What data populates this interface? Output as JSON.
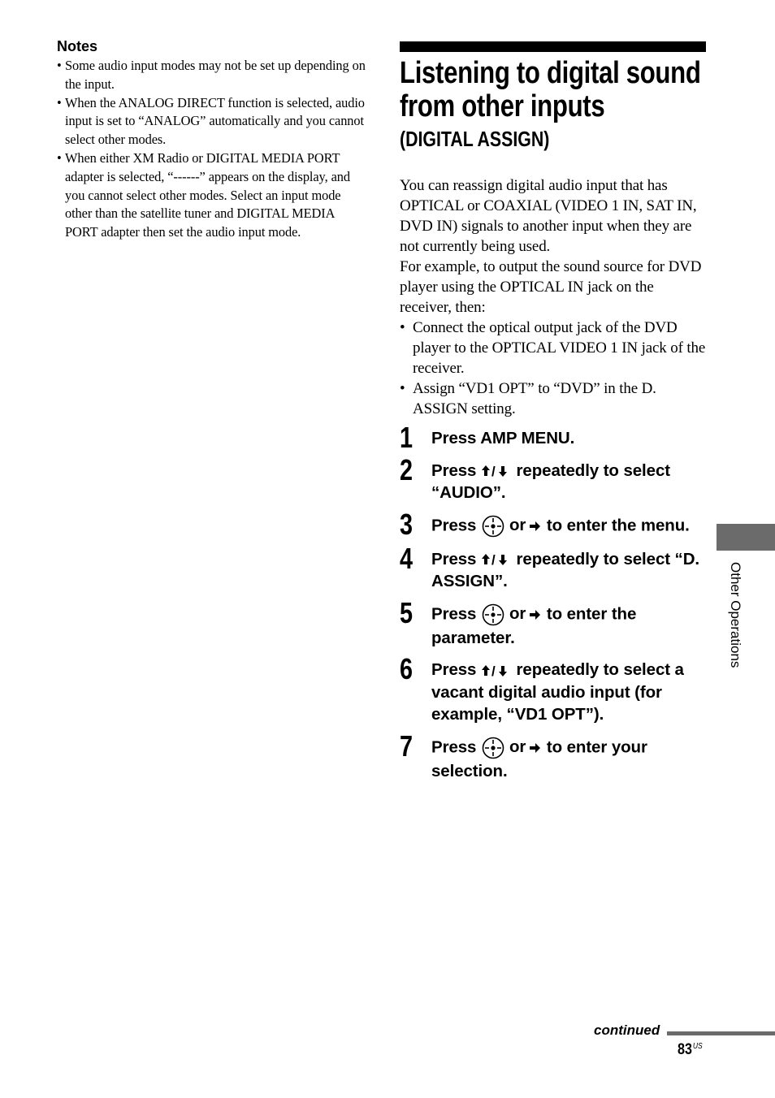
{
  "notes": {
    "title": "Notes",
    "items": [
      "Some audio input modes may not be set up depending on the input.",
      "When the ANALOG DIRECT function is selected, audio input is set to “ANALOG” automatically and you cannot select other modes.",
      "When either XM Radio or DIGITAL MEDIA PORT adapter is selected, “------” appears on the display, and you cannot select other modes. Select an input mode other than the satellite tuner and DIGITAL MEDIA PORT adapter then set the audio input mode."
    ]
  },
  "section": {
    "title": "Listening to digital sound from other inputs",
    "subtitle": "(DIGITAL ASSIGN)",
    "intro_paragraphs": [
      "You can reassign digital audio input that has OPTICAL or COAXIAL (VIDEO 1 IN, SAT IN, DVD IN) signals to another input when they are not currently being used.",
      "For example, to output the sound source for DVD player using the OPTICAL IN jack on the receiver, then:"
    ],
    "intro_bullets": [
      "Connect the optical output jack of the DVD player to the OPTICAL VIDEO 1 IN jack of the receiver.",
      "Assign “VD1 OPT” to “DVD” in the D. ASSIGN setting."
    ],
    "steps": [
      {
        "number": "1",
        "pre": "Press AMP MENU.",
        "icon": "",
        "post": ""
      },
      {
        "number": "2",
        "pre": "Press ",
        "icon": "up-down-arrows",
        "post": " repeatedly to select “AUDIO”."
      },
      {
        "number": "3",
        "pre": "Press ",
        "icon": "enter-button-or-right-arrow",
        "post": " to enter the menu."
      },
      {
        "number": "4",
        "pre": "Press ",
        "icon": "up-down-arrows",
        "post": " repeatedly to select “D. ASSIGN”."
      },
      {
        "number": "5",
        "pre": "Press ",
        "icon": "enter-button-or-right-arrow",
        "post": " to enter the parameter."
      },
      {
        "number": "6",
        "pre": "Press ",
        "icon": "up-down-arrows",
        "post": " repeatedly to select a vacant digital audio input (for example, “VD1 OPT”)."
      },
      {
        "number": "7",
        "pre": "Press ",
        "icon": "enter-button-or-right-arrow",
        "post": " to enter your selection."
      }
    ],
    "or_label": "or"
  },
  "side_tab": {
    "label": "Other Operations",
    "color": "#6b6b6b"
  },
  "footer": {
    "continued": "continued",
    "page_number": "83",
    "page_suffix": "US"
  }
}
